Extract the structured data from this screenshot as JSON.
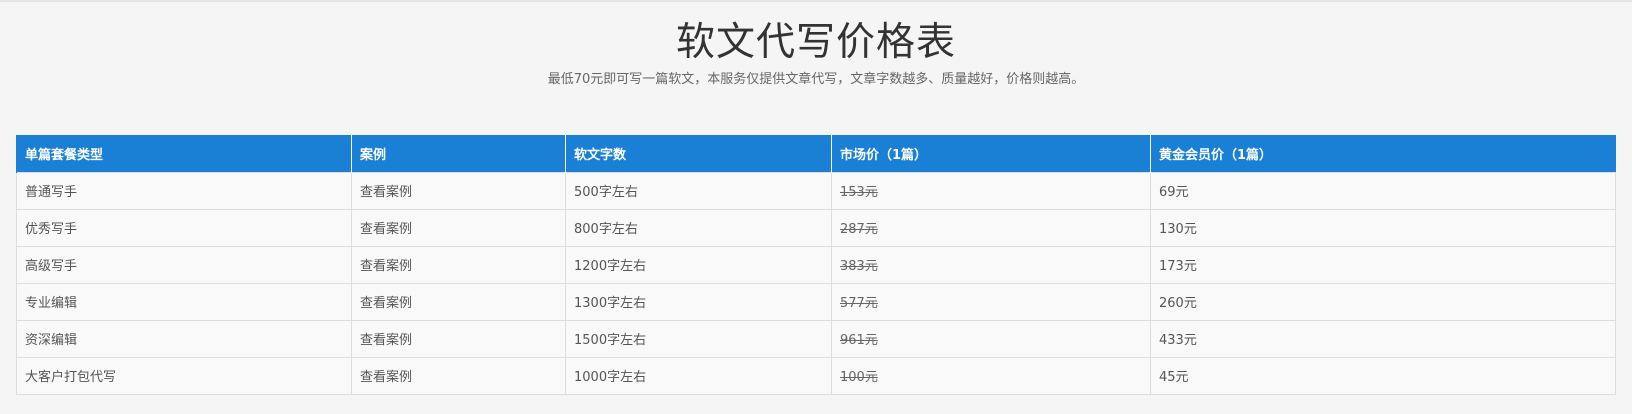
{
  "header": {
    "title": "软文代写价格表",
    "subtitle": "最低70元即可写一篇软文，本服务仅提供文章代写，文章字数越多、质量越好，价格则越高。"
  },
  "table": {
    "columns": [
      "单篇套餐类型",
      "案例",
      "软文字数",
      "市场价（1篇）",
      "黄金会员价（1篇）"
    ],
    "rows": [
      {
        "type": "普通写手",
        "case": "查看案例",
        "words": "500字左右",
        "market_price": "153元",
        "member_price": "69元"
      },
      {
        "type": "优秀写手",
        "case": "查看案例",
        "words": "800字左右",
        "market_price": "287元",
        "member_price": "130元"
      },
      {
        "type": "高级写手",
        "case": "查看案例",
        "words": "1200字左右",
        "market_price": "383元",
        "member_price": "173元"
      },
      {
        "type": "专业编辑",
        "case": "查看案例",
        "words": "1300字左右",
        "market_price": "577元",
        "member_price": "260元"
      },
      {
        "type": "资深编辑",
        "case": "查看案例",
        "words": "1500字左右",
        "market_price": "961元",
        "member_price": "433元"
      },
      {
        "type": "大客户打包代写",
        "case": "查看案例",
        "words": "1000字左右",
        "market_price": "100元",
        "member_price": "45元"
      }
    ]
  },
  "colors": {
    "header_bg": "#1a80d6",
    "header_text": "#ffffff",
    "page_bg": "#f5f5f5"
  }
}
